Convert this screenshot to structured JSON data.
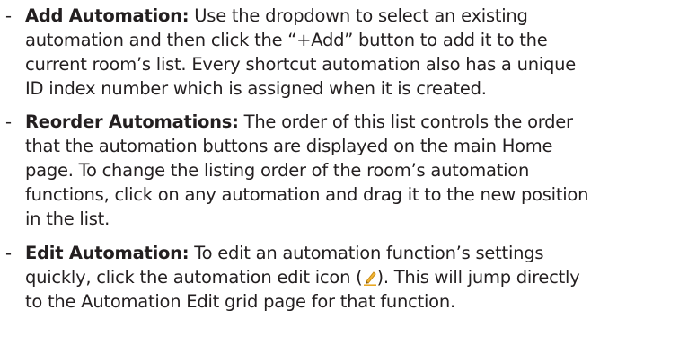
{
  "bullets": [
    {
      "marker": "-",
      "term": "Add Automation:",
      "lines": [
        " Use the dropdown to select an existing",
        "automation and then click the “+Add” button to add it to the",
        "current room’s list. Every shortcut automation also has a unique",
        "ID index number which is assigned when it is created."
      ]
    },
    {
      "marker": "-",
      "term": "Reorder Automations:",
      "lines": [
        " The order of this list controls the order",
        "that the automation buttons are displayed on the main Home",
        "page. To change the listing order of the room’s automation",
        "functions, click on any automation and drag it to the new position",
        "in the list."
      ]
    },
    {
      "marker": "-",
      "term": "Edit Automation:",
      "lines": [
        " To edit an automation function’s settings",
        "quickly, click the automation edit icon (",
        "). This will jump directly",
        "to the Automation Edit grid page for that function."
      ],
      "icon": "pencil-edit-icon",
      "icon_color": "#e8a317"
    }
  ]
}
